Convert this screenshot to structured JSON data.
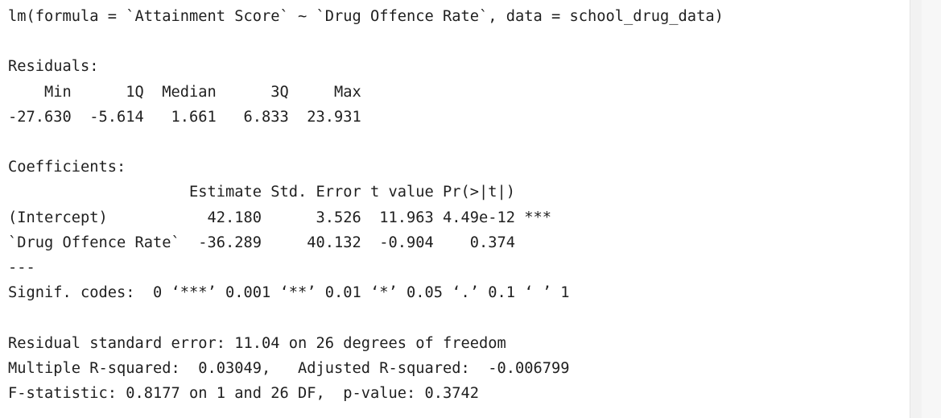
{
  "console": {
    "call": "lm(formula = `Attainment Score` ~ `Drug Offence Rate`, data = school_drug_data)",
    "residuals_heading": "Residuals:",
    "residuals_header": "    Min      1Q  Median      3Q     Max ",
    "residuals_values": "-27.630  -5.614   1.661   6.833  23.931 ",
    "coefficients_heading": "Coefficients:",
    "coef_header": "                    Estimate Std. Error t value Pr(>|t|)    ",
    "coef_row_intercept": "(Intercept)           42.180      3.526  11.963 4.49e-12 ***",
    "coef_row_drug": "`Drug Offence Rate`  -36.289     40.132  -0.904    0.374    ",
    "separator": "---",
    "signif_codes": "Signif. codes:  0 ‘***’ 0.001 ‘**’ 0.01 ‘*’ 0.05 ‘.’ 0.1 ‘ ’ 1",
    "rse": "Residual standard error: 11.04 on 26 degrees of freedom",
    "r_squared": "Multiple R-squared:  0.03049,\tAdjusted R-squared:  -0.006799 ",
    "f_statistic": "F-statistic: 0.8177 on 1 and 26 DF,  p-value: 0.3742"
  }
}
